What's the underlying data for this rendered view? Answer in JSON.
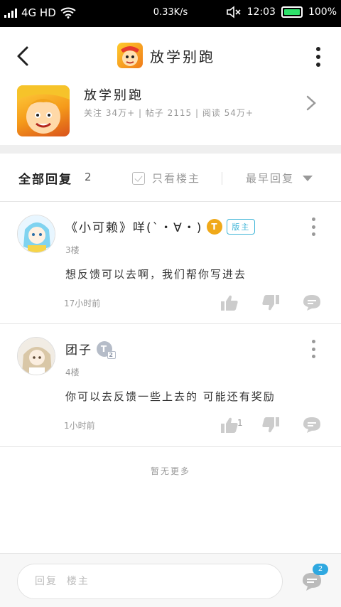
{
  "status_bar": {
    "network": "4G HD",
    "speed": "0.33K/s",
    "time": "12:03",
    "battery": "100%"
  },
  "header": {
    "title": "放学别跑"
  },
  "forum": {
    "name": "放学别跑",
    "stats": "关注 34万+ | 帖子 2115 | 阅读 54万+"
  },
  "replies_bar": {
    "title": "全部回复",
    "count": "2",
    "only_op_label": "只看楼主",
    "sort_label": "最早回复"
  },
  "comments": [
    {
      "name": "《小可赖》咩(`・∀・)",
      "level_badge": "T",
      "role_badge": "版主",
      "floor": "3楼",
      "text": "想反馈可以去啊，我们帮你写进去",
      "time": "17小时前",
      "likes": ""
    },
    {
      "name": "团子",
      "level_badge": "T",
      "level_sub": "2",
      "floor": "4楼",
      "text": "你可以去反馈一些上去的 可能还有奖励",
      "time": "1小时前",
      "likes": "1"
    }
  ],
  "footer_note": "暂无更多",
  "bottom_bar": {
    "placeholder": "回复  楼主",
    "message_badge": "2"
  },
  "colors": {
    "accent": "#3fb5d8",
    "gold_badge": "#f0a91a",
    "grey_badge": "#b5bcc8",
    "battery": "#2ee06a",
    "notification": "#2fa8e0"
  }
}
